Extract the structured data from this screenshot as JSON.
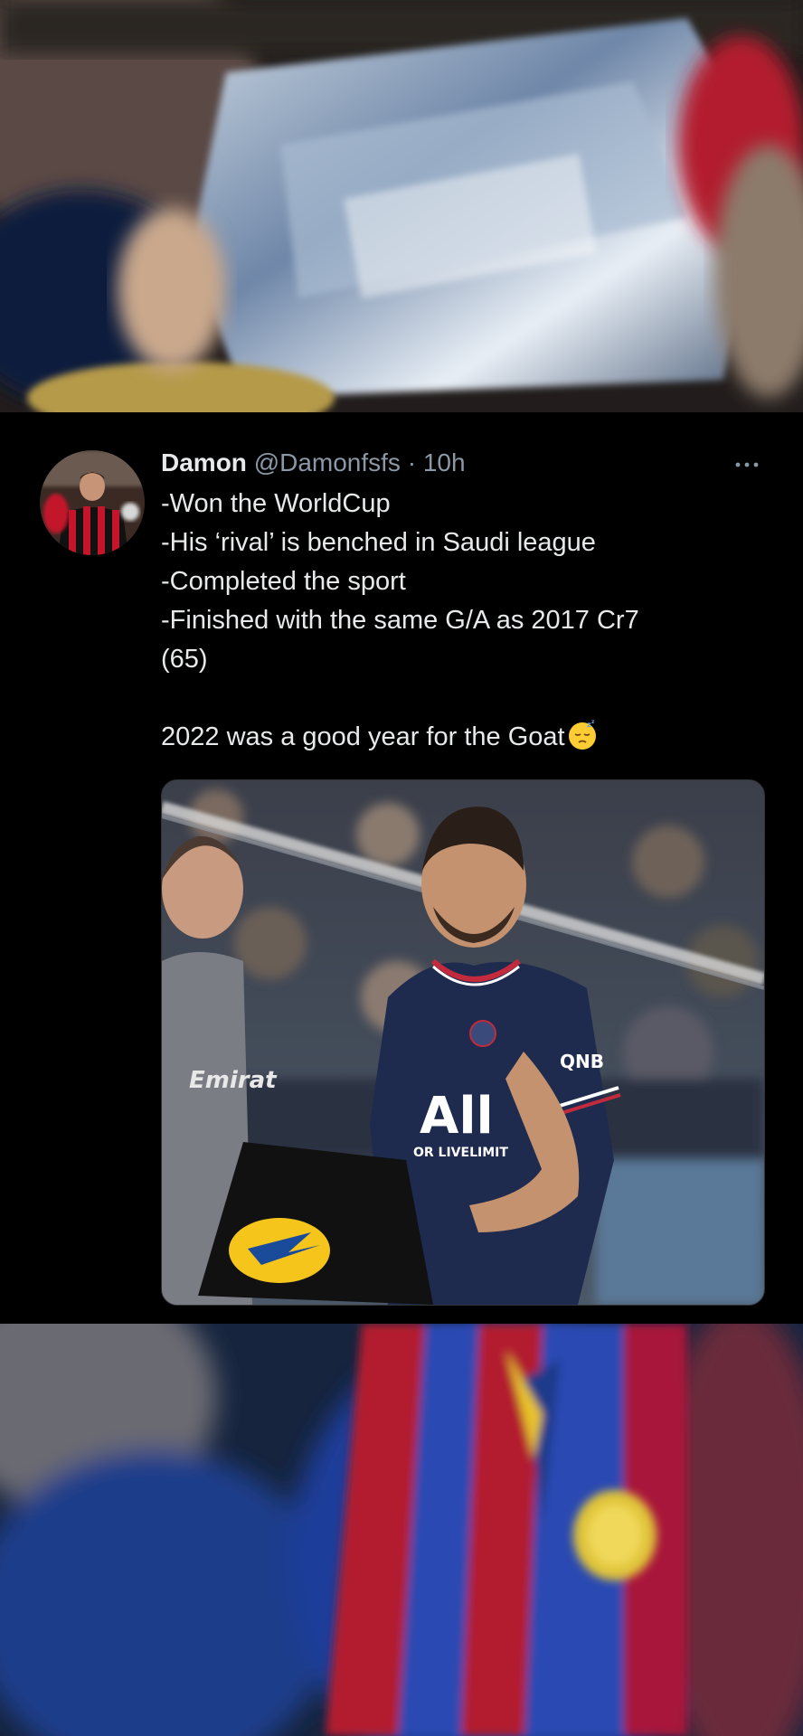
{
  "tweet": {
    "display_name": "Damon",
    "handle": "@Damonfsfs",
    "separator": "·",
    "time": "10h",
    "lines": [
      "-Won the WorldCup",
      "-His ‘rival’ is benched in Saudi league",
      "-Completed the sport",
      "-Finished with the same G/A as 2017 Cr7",
      "(65)"
    ],
    "closing_line": "2022 was a good year for the Goat",
    "closing_emoji": "sleepy-face-emoji"
  },
  "media": {
    "sponsor_text": "QNB",
    "shirt_text": "All",
    "shirt_subtext": "OR LIVELIMIT",
    "coach_text": "Emirat"
  },
  "icons": {
    "more": "more-options-icon"
  },
  "colors": {
    "background": "#000000",
    "text_primary": "#e7e9ea",
    "text_secondary": "#8b98a5"
  }
}
